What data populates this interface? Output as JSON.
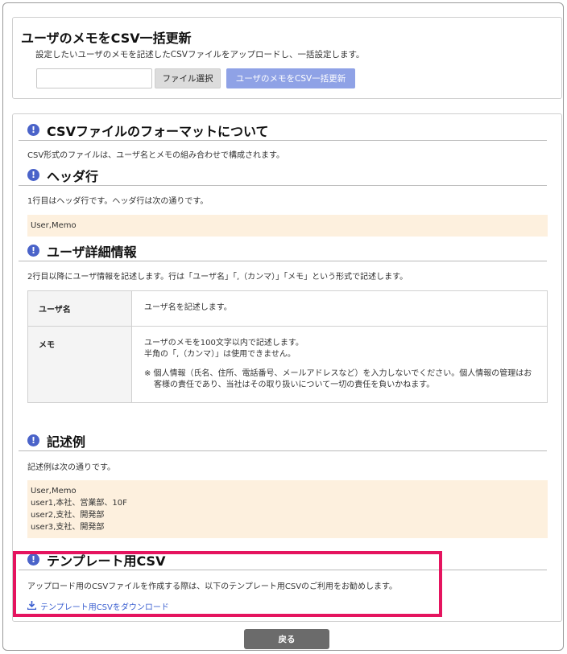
{
  "bulk_update": {
    "title": "ユーザのメモをCSV一括更新",
    "description": "設定したいユーザのメモを記述したCSVファイルをアップロードし、一括設定します。",
    "file_input_value": "",
    "select_file_label": "ファイル選択",
    "update_button_label": "ユーザのメモをCSV一括更新"
  },
  "format": {
    "title": "CSVファイルのフォーマットについて",
    "description": "CSV形式のファイルは、ユーザ名とメモの組み合わせで構成されます。"
  },
  "header_row": {
    "title": "ヘッダ行",
    "description": "1行目はヘッダ行です。ヘッダ行は次の通りです。",
    "code": "User,Memo"
  },
  "user_detail": {
    "title": "ユーザ詳細情報",
    "description": "2行目以降にユーザ情報を記述します。行は「ユーザ名」「,（カンマ）」「メモ」という形式で記述します。",
    "rows": [
      {
        "key": "ユーザ名",
        "lines": [
          "ユーザ名を記述します。"
        ],
        "note": ""
      },
      {
        "key": "メモ",
        "lines": [
          "ユーザのメモを100文字以内で記述します。",
          "半角の「,（カンマ）」は使用できません。"
        ],
        "note": "※ 個人情報（氏名、住所、電話番号、メールアドレスなど）を入力しないでください。個人情報の管理はお客様の責任であり、当社はその取り扱いについて一切の責任を負いかねます。"
      }
    ]
  },
  "example": {
    "title": "記述例",
    "description": "記述例は次の通りです。",
    "lines": [
      "User,Memo",
      "user1,本社、営業部、10F",
      "user2,支社、開発部",
      "user3,支社、開発部"
    ]
  },
  "template": {
    "title": "テンプレート用CSV",
    "description": "アップロード用のCSVファイルを作成する際は、以下のテンプレート用CSVのご利用をお勧めします。",
    "download_label": "テンプレート用CSVをダウンロード"
  },
  "back_button_label": "戻る",
  "colors": {
    "accent": "#4a63c9",
    "update_button": "#8fa2e6",
    "code_background": "#fdf0de",
    "highlight": "#e5145f",
    "back_button": "#6b6b6b"
  },
  "icons": {
    "section": "info-circle-icon",
    "download": "download-icon"
  }
}
